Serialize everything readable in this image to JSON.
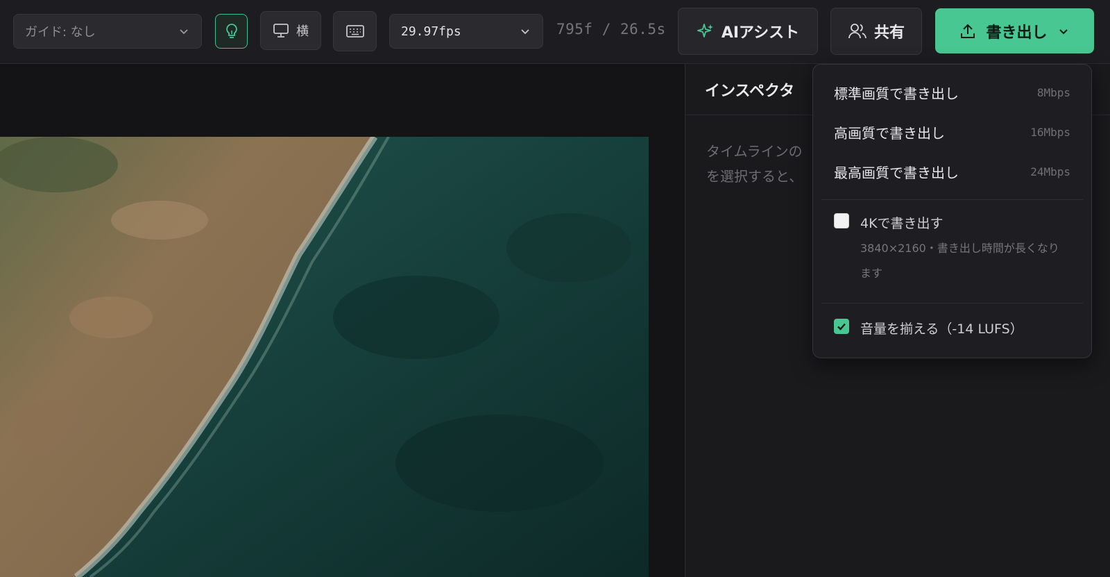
{
  "toolbar": {
    "guide_select": {
      "value": "ガイド: なし"
    },
    "orientation_label": "横",
    "fps_select": {
      "value": "29.97fps"
    },
    "frame_count": "795f / 26.5s",
    "ai_assist_label": "AIアシスト",
    "share_label": "共有",
    "export_label": "書き出し"
  },
  "inspector": {
    "title": "インスペクタ",
    "hint_line1": "タイムラインの",
    "hint_line2": "を選択すると、"
  },
  "export_menu": {
    "items": [
      {
        "label": "標準画質で書き出し",
        "rate": "8Mbps"
      },
      {
        "label": "高画質で書き出し",
        "rate": "16Mbps"
      },
      {
        "label": "最高画質で書き出し",
        "rate": "24Mbps"
      }
    ],
    "option_4k": {
      "label": "4Kで書き出す",
      "sublabel": "3840×2160・書き出し時間が長くなります",
      "checked": false
    },
    "option_loudness": {
      "label": "音量を揃える（-14 LUFS）",
      "checked": true
    }
  },
  "colors": {
    "accent": "#48c793",
    "background": "#141416",
    "toolbar": "#1d1d21"
  }
}
